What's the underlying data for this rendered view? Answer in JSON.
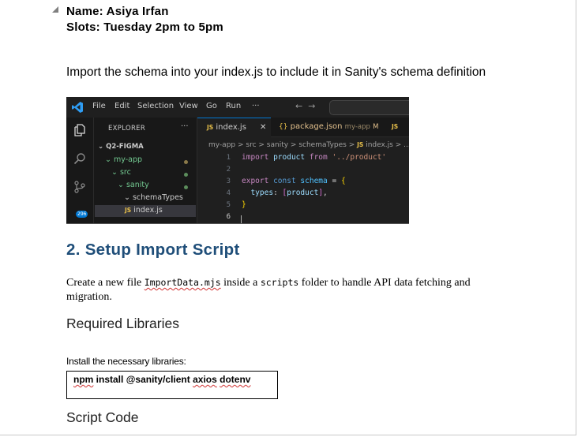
{
  "header": {
    "name_line": "Name: Asiya Irfan",
    "slots_line": "Slots: Tuesday 2pm to 5pm"
  },
  "intro": "Import the schema into your index.js to include it in Sanity's schema definition",
  "vscode": {
    "menu": [
      "File",
      "Edit",
      "Selection",
      "View",
      "Go",
      "Run",
      "···"
    ],
    "explorer_title": "EXPLORER",
    "explorer_more": "···",
    "badge": "296",
    "tree": {
      "root": "Q2-FIGMA",
      "app": "my-app",
      "src": "src",
      "sanity": "sanity",
      "schemaTypes": "schemaTypes",
      "file_prefix": "JS",
      "file": "index.js"
    },
    "tabs": {
      "active_prefix": "JS",
      "active": "index.js",
      "close": "✕",
      "second_prefix": "{}",
      "second": "package.json",
      "second_path": "my-app",
      "second_status": "M",
      "third_prefix": "JS"
    },
    "breadcrumb": "my-app > src > sanity > schemaTypes > ",
    "breadcrumb_file_prefix": "JS",
    "breadcrumb_file": "index.js > ...",
    "line_numbers": [
      "1",
      "2",
      "3",
      "4",
      "5",
      "6"
    ],
    "code": {
      "l1_import": "import",
      "l1_id": "product",
      "l1_from": "from",
      "l1_str": "'../product'",
      "l3_export": "export",
      "l3_const": "const",
      "l3_id": "schema",
      "l3_eq": "=",
      "l3_brace": "{",
      "l4_key": "types",
      "l4_colon": ":",
      "l4_open": "[",
      "l4_id": "product",
      "l4_close": "]",
      "l4_comma": ",",
      "l5_brace": "}"
    }
  },
  "section": {
    "title": "2. Setup Import Script",
    "para_a": "Create a new file ",
    "file": "ImportData.mjs",
    "para_b": " inside a ",
    "folder": "scripts",
    "para_c": " folder to handle API data fetching and migration.",
    "required_libs": "Required Libraries",
    "install_label": "Install the necessary libraries:",
    "cmd_a": "npm",
    "cmd_b": " install @sanity/client ",
    "cmd_c": "axios",
    "cmd_d": " ",
    "cmd_e": "dotenv",
    "script_code": "Script Code"
  }
}
